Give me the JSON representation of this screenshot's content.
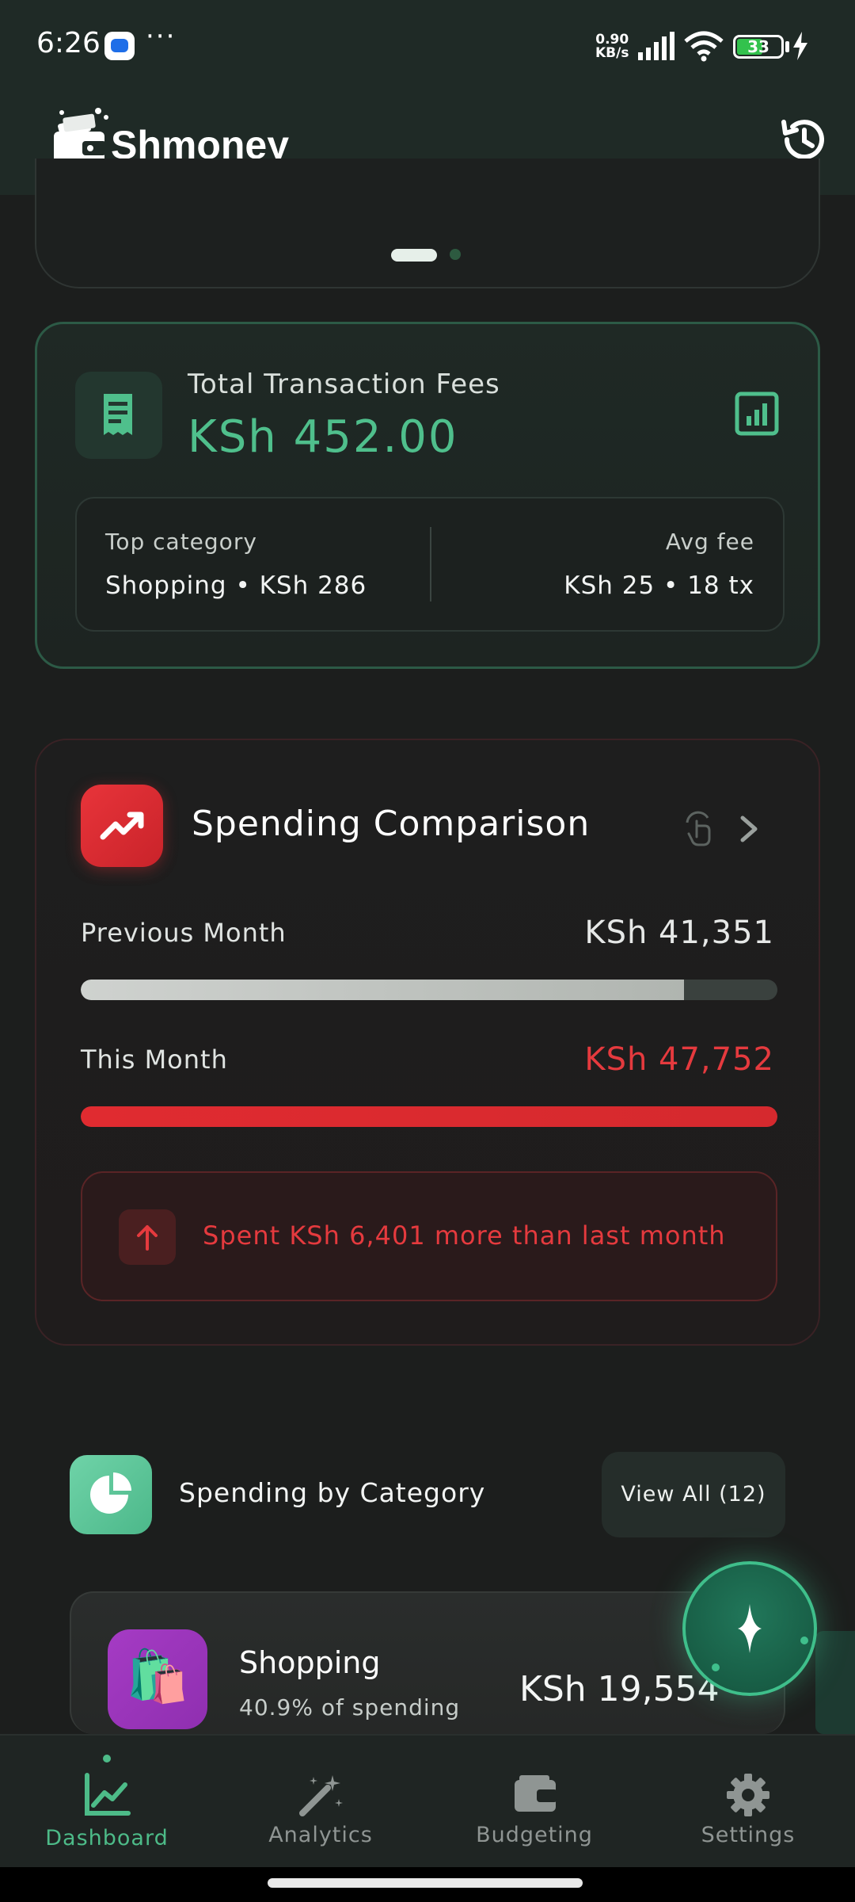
{
  "status_bar": {
    "time": "6:26",
    "net_speed_value": "0.90",
    "net_speed_unit": "KB/s",
    "battery": "33"
  },
  "app": {
    "title": "Shmoney"
  },
  "fees_card": {
    "label": "Total Transaction Fees",
    "value": "KSh 452.00",
    "top_category_label": "Top category",
    "top_category_value": "Shopping • KSh 286",
    "avg_fee_label": "Avg fee",
    "avg_fee_value": "KSh 25 • 18 tx"
  },
  "spending_comparison": {
    "title": "Spending Comparison",
    "previous_label": "Previous Month",
    "previous_value": "KSh 41,351",
    "previous_amount": 41351,
    "this_label": "This Month",
    "this_value": "KSh 47,752",
    "this_amount": 47752,
    "alert_text": "Spent KSh 6,401 more than last month"
  },
  "category_section": {
    "title": "Spending by Category",
    "view_all_label": "View All (12)",
    "items": [
      {
        "emoji": "🛍️",
        "name": "Shopping",
        "subtitle": "40.9% of spending",
        "amount": "KSh 19,554"
      }
    ]
  },
  "bottom_nav": {
    "items": [
      {
        "label": "Dashboard",
        "icon": "chart-line-icon",
        "active": true
      },
      {
        "label": "Analytics",
        "icon": "magic-wand-icon",
        "active": false
      },
      {
        "label": "Budgeting",
        "icon": "wallet-icon",
        "active": false
      },
      {
        "label": "Settings",
        "icon": "gear-icon",
        "active": false
      }
    ]
  },
  "colors": {
    "accent_green": "#4fbf8c",
    "alert_red": "#e53a3e",
    "background": "#1c1e1d"
  }
}
